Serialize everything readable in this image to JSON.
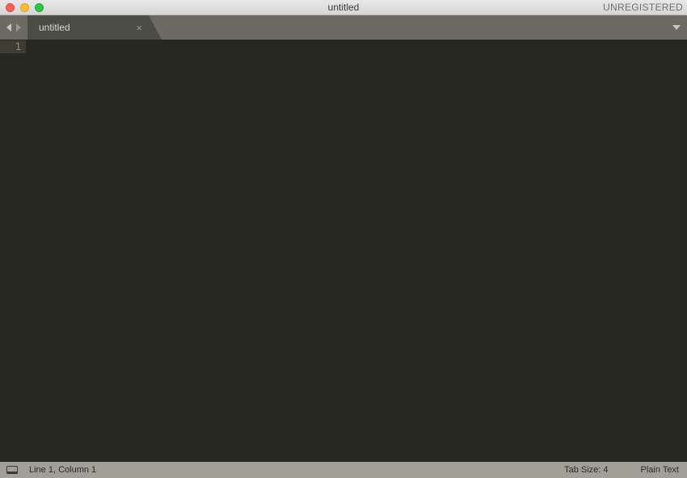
{
  "titlebar": {
    "title": "untitled",
    "registration": "UNREGISTERED"
  },
  "tabs": {
    "active": {
      "label": "untitled"
    }
  },
  "editor": {
    "line_number": "1"
  },
  "statusbar": {
    "cursor": "Line 1, Column 1",
    "tab_size": "Tab Size: 4",
    "syntax": "Plain Text"
  }
}
